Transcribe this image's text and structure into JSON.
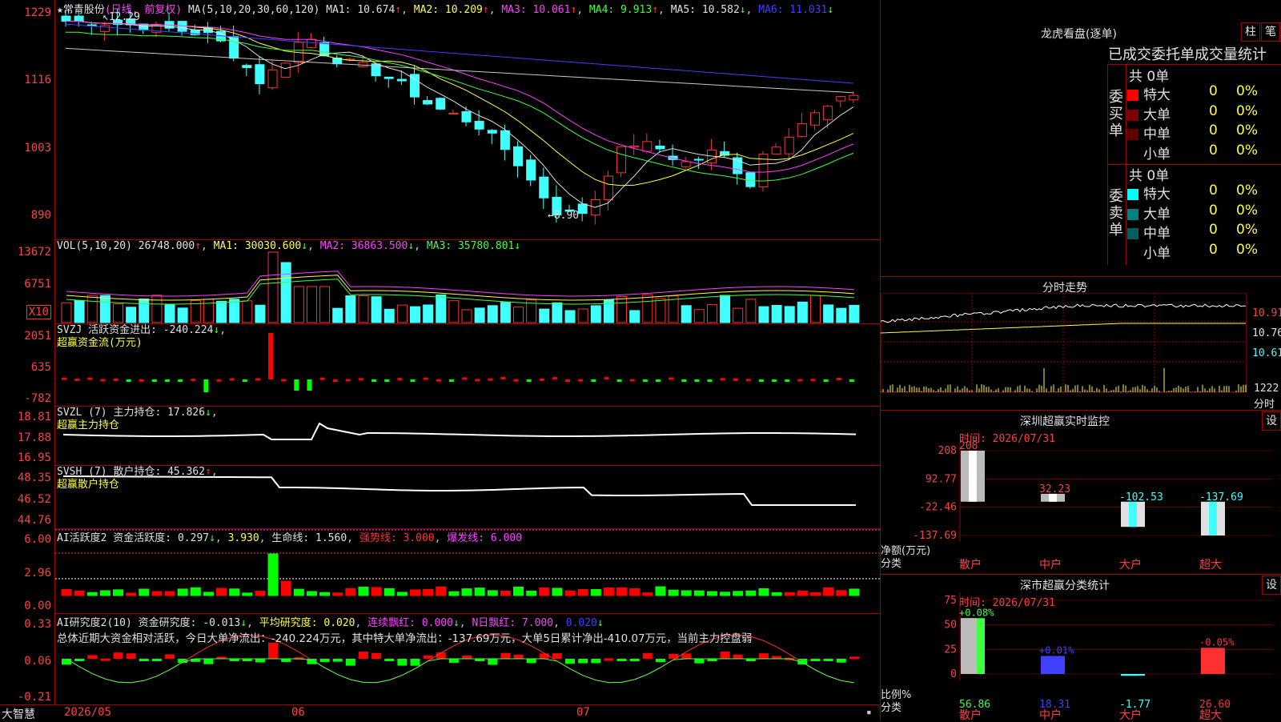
{
  "stock": {
    "name": "常青股份",
    "period": "(日线, 前复权)",
    "ma_label": "MA(5,10,20,30,60,120)",
    "ma": [
      {
        "label": "MA1: 10.674",
        "color": "#e0e0e0"
      },
      {
        "label": "MA2: 10.209",
        "color": "#ffff40"
      },
      {
        "label": "MA3: 10.061",
        "color": "#ff40ff"
      },
      {
        "label": "MA4: 9.913",
        "color": "#40ff40"
      },
      {
        "label": "MA5: 10.582",
        "color": "#e0e0e0"
      },
      {
        "label": "MA6: 11.031",
        "color": "#4040ff"
      }
    ],
    "high_mark": "12.29",
    "low_mark": "8.90",
    "price_axis": [
      "1229",
      "1116",
      "1003",
      "890"
    ]
  },
  "volume": {
    "header": "VOL(5,10,20)",
    "value": "26748.000",
    "ma1": "MA1: 30030.600",
    "ma2": "MA2: 36863.500",
    "ma3": "MA3: 35780.801",
    "axis": [
      "13672",
      "6751"
    ],
    "unit": "X10"
  },
  "svzj": {
    "header": "SVZJ  活跃资金进出: -240.224",
    "subtitle": "超赢资金流(万元)",
    "axis": [
      "2051",
      "635",
      "-782"
    ]
  },
  "svzl": {
    "header": "SVZL (7) 主力持仓: 17.826",
    "subtitle": "超赢主力持仓",
    "axis": [
      "18.81",
      "17.88",
      "16.95"
    ]
  },
  "svsh": {
    "header": "SVSH (7) 散户持仓: 45.362",
    "subtitle": "超赢散户持仓",
    "axis": [
      "48.35",
      "46.52",
      "44.76"
    ]
  },
  "ai_active": {
    "header_white": "AI活跃度2 资金活跃度: 0.297",
    "v2": "3.930",
    "life": "生命线: 1.560",
    "strong": "强势线: 3.000",
    "burst": "爆发线: 6.000",
    "axis": [
      "6.00",
      "2.96",
      "0.00"
    ]
  },
  "ai_research": {
    "header_white": "AI研究度2(10) 资金研究度: -0.013",
    "avg": "平均研究度: 0.020",
    "cont": "连续飘红: 0.000",
    "nday": "N日飘红: 7.000",
    "last": "0.020",
    "summary": "总体近期大资金相对活跃，今日大单净流出：-240.224万元，其中特大单净流出：-137.69万元，大单5日累计净出-410.07万元，当前主力控盘弱",
    "axis": [
      "0.33",
      "0.06",
      "-0.21"
    ]
  },
  "date_axis": [
    "2026/05",
    "06",
    "07"
  ],
  "brand": "大智慧",
  "right": {
    "title": "龙虎看盘(逐单)",
    "btn_zhu": "柱",
    "btn_bi": "笔",
    "tabs": "已成交委托单成交量统计",
    "buy_total": "共 0单",
    "sell_total": "共 0单",
    "buy_label": "委买单",
    "sell_label": "委卖单",
    "buy_rows": [
      {
        "name": "特大",
        "n": "0",
        "p": "0%",
        "color": "#ff0000"
      },
      {
        "name": "大单",
        "n": "0",
        "p": "0%",
        "color": "#800000"
      },
      {
        "name": "中单",
        "n": "0",
        "p": "0%",
        "color": "#600000"
      },
      {
        "name": "小单",
        "n": "0",
        "p": "0%",
        "color": "#000000"
      }
    ],
    "sell_rows": [
      {
        "name": "特大",
        "n": "0",
        "p": "0%",
        "color": "#00ffff"
      },
      {
        "name": "大单",
        "n": "0",
        "p": "0%",
        "color": "#008080"
      },
      {
        "name": "中单",
        "n": "0",
        "p": "0%",
        "color": "#006060"
      },
      {
        "name": "小单",
        "n": "0",
        "p": "0%",
        "color": "#000000"
      }
    ],
    "intraday_title": "分时走势",
    "intraday_axis": [
      "10.91",
      "10.76",
      "10.61",
      "1222"
    ],
    "intraday_unit": "分时",
    "monitor_title": "深圳超赢实时监控",
    "monitor_btn": "设",
    "monitor_time": "时间: 2026/07/31",
    "monitor_axis": [
      "208",
      "92.77",
      "-22.46",
      "-137.69"
    ],
    "monitor_ylabel": "净额(万元)",
    "monitor_xlabel": "分类",
    "stats_title": "深市超赢分类统计",
    "stats_btn": "设",
    "stats_time": "时间: 2026/07/31",
    "stats_axis": [
      "75",
      "50",
      "25",
      "0"
    ],
    "stats_ylabel": "比例%",
    "stats_xlabel": "分类"
  },
  "chart_data": [
    {
      "type": "bar",
      "title": "深圳超赢实时监控",
      "ylabel": "净额(万元)",
      "xlabel": "分类",
      "categories": [
        "散户",
        "中户",
        "大户",
        "超大"
      ],
      "values": [
        208,
        32.23,
        -102.53,
        -137.69
      ],
      "value_labels": [
        "208",
        "32.23",
        "-102.53",
        "-137.69"
      ],
      "ylim": [
        -137.69,
        208
      ],
      "colors": [
        "#e0e0e0",
        "#e0e0e0",
        "#40ffff",
        "#40ffff"
      ]
    },
    {
      "type": "bar",
      "title": "深市超赢分类统计",
      "ylabel": "比例%",
      "xlabel": "分类",
      "categories": [
        "散户",
        "中户",
        "大户",
        "超大"
      ],
      "values": [
        56.86,
        18.31,
        -1.77,
        26.6
      ],
      "value_labels": [
        "56.86",
        "18.31",
        "-1.77",
        "26.60"
      ],
      "change_labels": [
        "+0.08%",
        "+0.01%",
        "",
        "-0.05%"
      ],
      "ylim": [
        0,
        75
      ],
      "colors": [
        "#40ff40",
        "#4040ff",
        "#40ffff",
        "#ff3030"
      ]
    }
  ]
}
